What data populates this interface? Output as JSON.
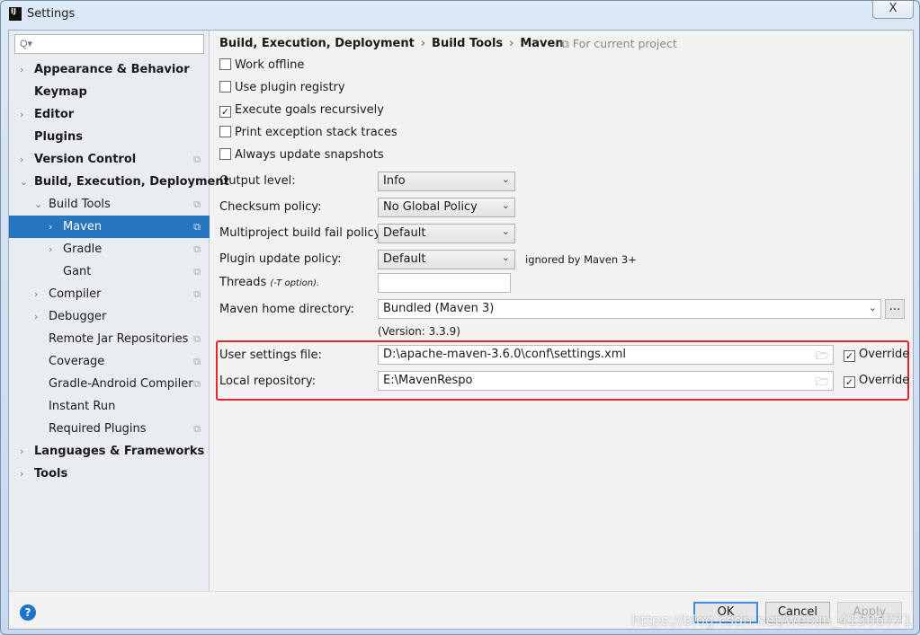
{
  "window": {
    "title": "Settings",
    "close": "X",
    "app_icon": "IJ"
  },
  "search": {
    "placeholder": "Q▾"
  },
  "sidebar": {
    "items": [
      {
        "label": "Appearance & Behavior",
        "level": 0,
        "bold": true,
        "arrow": "›"
      },
      {
        "label": "Keymap",
        "level": 0,
        "bold": true
      },
      {
        "label": "Editor",
        "level": 0,
        "bold": true,
        "arrow": "›"
      },
      {
        "label": "Plugins",
        "level": 0,
        "bold": true
      },
      {
        "label": "Version Control",
        "level": 0,
        "bold": true,
        "arrow": "›",
        "copy": true
      },
      {
        "label": "Build, Execution, Deployment",
        "level": 0,
        "bold": true,
        "arrow": "⌄"
      },
      {
        "label": "Build Tools",
        "level": 1,
        "arrow": "⌄",
        "copy": true
      },
      {
        "label": "Maven",
        "level": 2,
        "arrow": "›",
        "copy": true,
        "selected": true
      },
      {
        "label": "Gradle",
        "level": 2,
        "arrow": "›",
        "copy": true
      },
      {
        "label": "Gant",
        "level": 2,
        "copy": true
      },
      {
        "label": "Compiler",
        "level": 1,
        "arrow": "›",
        "copy": true
      },
      {
        "label": "Debugger",
        "level": 1,
        "arrow": "›"
      },
      {
        "label": "Remote Jar Repositories",
        "level": 1,
        "copy": true
      },
      {
        "label": "Coverage",
        "level": 1,
        "copy": true
      },
      {
        "label": "Gradle-Android Compiler",
        "level": 1,
        "copy": true
      },
      {
        "label": "Instant Run",
        "level": 1
      },
      {
        "label": "Required Plugins",
        "level": 1,
        "copy": true
      },
      {
        "label": "Languages & Frameworks",
        "level": 0,
        "bold": true,
        "arrow": "›"
      },
      {
        "label": "Tools",
        "level": 0,
        "bold": true,
        "arrow": "›"
      }
    ]
  },
  "breadcrumb": {
    "items": [
      "Build, Execution, Deployment",
      "Build Tools",
      "Maven"
    ],
    "scope": "For current project"
  },
  "checkboxes": [
    {
      "label": "Work offline",
      "checked": false
    },
    {
      "label": "Use plugin registry",
      "checked": false
    },
    {
      "label": "Execute goals recursively",
      "checked": true
    },
    {
      "label": "Print exception stack traces",
      "checked": false
    },
    {
      "label": "Always update snapshots",
      "checked": false
    }
  ],
  "dropdowns": [
    {
      "label": "Output level:",
      "value": "Info"
    },
    {
      "label": "Checksum policy:",
      "value": "No Global Policy"
    },
    {
      "label": "Multiproject build fail policy:",
      "value": "Default"
    },
    {
      "label": "Plugin update policy:",
      "value": "Default",
      "note": "ignored by Maven 3+"
    }
  ],
  "threads": {
    "label": "Threads",
    "hint": "(-T option).",
    "value": ""
  },
  "maven_home": {
    "label": "Maven home directory:",
    "value": "Bundled (Maven 3)",
    "browse": "...",
    "version": "(Version: 3.3.9)"
  },
  "user_settings": {
    "label": "User settings file:",
    "value": "D:\\apache-maven-3.6.0\\conf\\settings.xml",
    "override_label": "Override",
    "override": true
  },
  "local_repo": {
    "label": "Local repository:",
    "value": "E:\\MavenRespo",
    "override_label": "Override",
    "override": true
  },
  "buttons": {
    "ok": "OK",
    "cancel": "Cancel",
    "apply": "Apply",
    "help": "?"
  },
  "watermark": "https://blog.csdn.net/weixin_41306771",
  "colors": {
    "selection": "#2675bf",
    "highlight_box": "#e8252b"
  }
}
